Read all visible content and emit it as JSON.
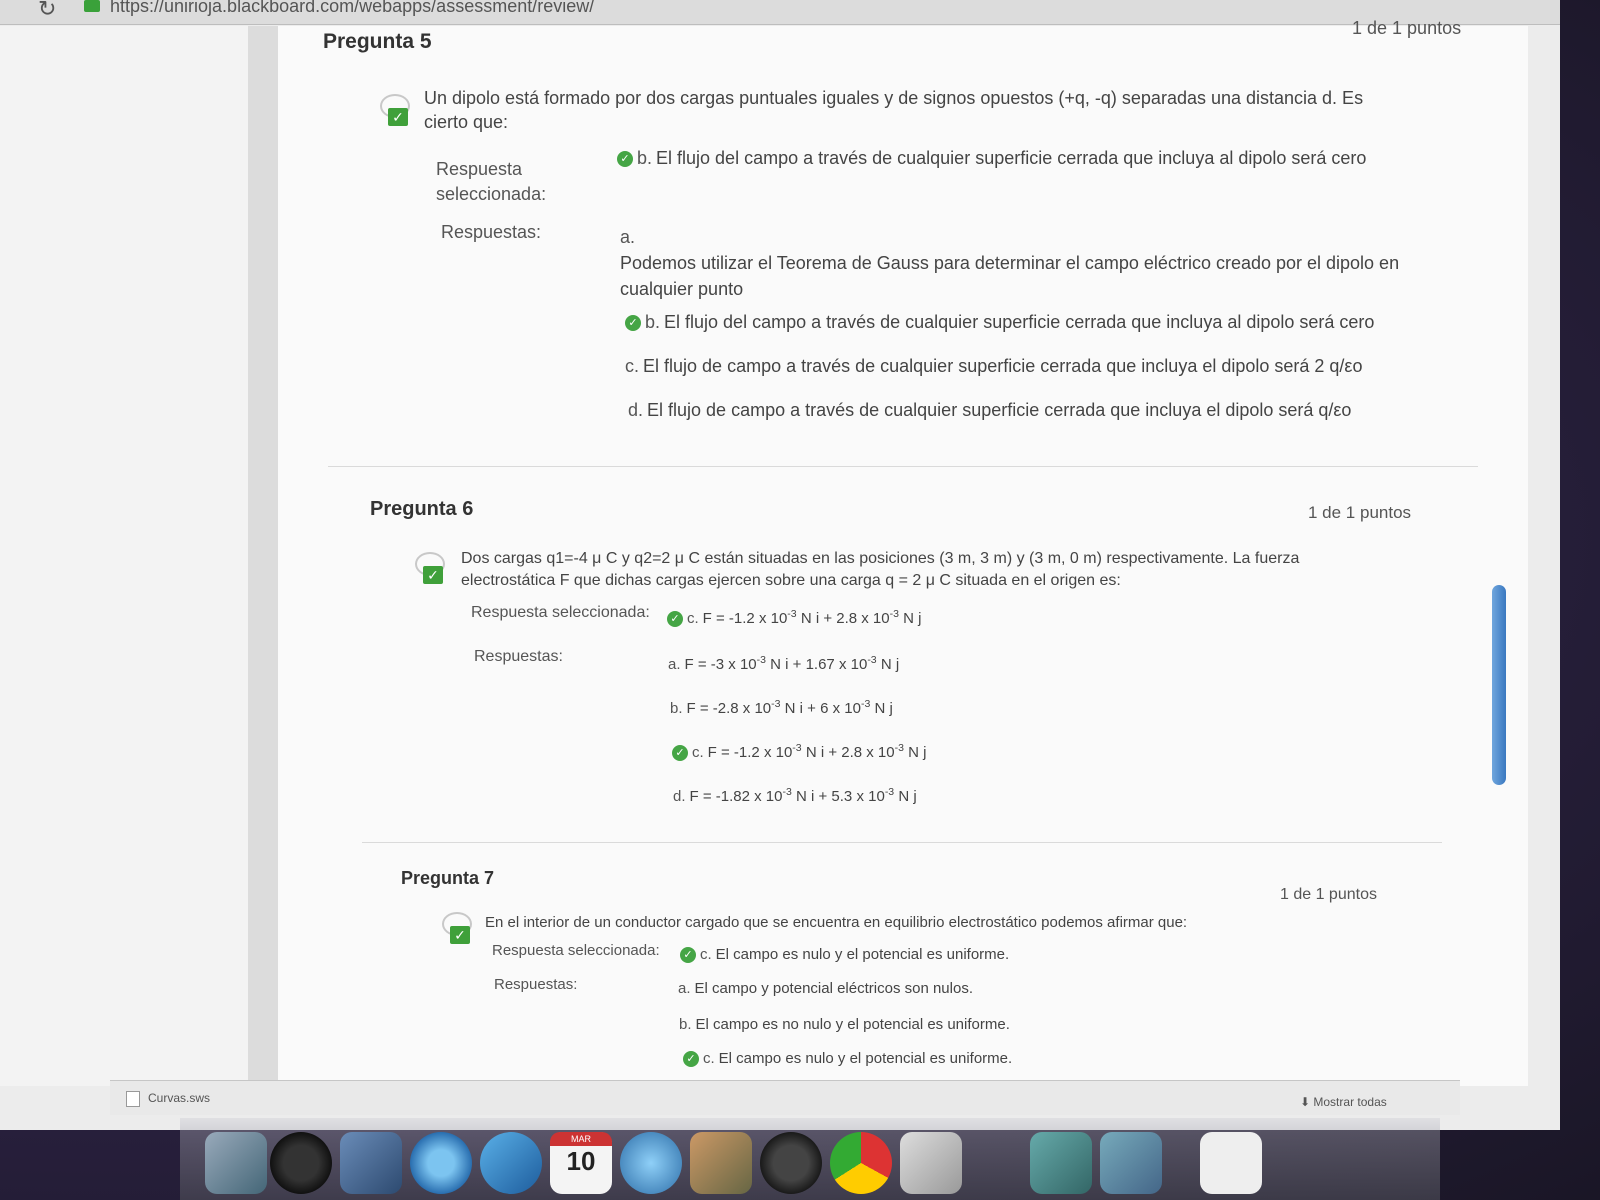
{
  "browser": {
    "url": "https://unirioja.blackboard.com/webapps/assessment/review/"
  },
  "questions": {
    "q5": {
      "title": "Pregunta 5",
      "points": "1 de 1 puntos",
      "stem_line1": "Un dipolo está formado por dos cargas puntuales iguales y de signos opuestos (+q, -q) separadas una distancia d. Es",
      "stem_line2": "cierto que:",
      "selected_label_1": "Respuesta",
      "selected_label_2": "seleccionada:",
      "selected_letter": "b.",
      "selected_text": "El flujo del campo a través de cualquier superficie cerrada que incluya al dipolo será cero",
      "answers_label": "Respuestas:",
      "answers": [
        {
          "letter": "a.",
          "text_1": "Podemos utilizar el Teorema de Gauss para determinar el campo eléctrico creado por el dipolo en",
          "text_2": "cualquier punto"
        },
        {
          "letter": "b.",
          "text": "El flujo del campo a través de cualquier superficie cerrada que incluya al dipolo será cero"
        },
        {
          "letter": "c.",
          "text": "El flujo de campo a través de cualquier superficie cerrada que incluya el dipolo será 2 q/εo"
        },
        {
          "letter": "d.",
          "text": "El flujo de campo a través de cualquier superficie cerrada que incluya el dipolo será q/εo"
        }
      ]
    },
    "q6": {
      "title": "Pregunta 6",
      "points": "1 de 1 puntos",
      "stem_line1": "Dos cargas q1=-4 μ C y q2=2 μ C están situadas en las posiciones (3 m, 3 m) y (3 m, 0 m) respectivamente. La fuerza",
      "stem_line2": "electrostática F que dichas cargas ejercen sobre una carga q = 2 μ C situada en el origen es:",
      "selected_label": "Respuesta seleccionada:",
      "answers_label": "Respuestas:",
      "selected": {
        "letter": "c.",
        "a": "F = -1.2 x 10",
        "b": "N i + 2.8 x 10",
        "c": "N j",
        "exp": "-3"
      },
      "answers": [
        {
          "letter": "a.",
          "a": "F = -3 x 10",
          "b": "N i + 1.67 x 10",
          "c": "N j",
          "exp": "-3"
        },
        {
          "letter": "b.",
          "a": "F = -2.8 x 10",
          "b": "N i + 6 x 10",
          "c": "N j",
          "exp": "-3"
        },
        {
          "letter": "c.",
          "a": "F = -1.2 x 10",
          "b": "N i + 2.8 x 10",
          "c": "N j",
          "exp": "-3"
        },
        {
          "letter": "d.",
          "a": "F = -1.82 x 10",
          "b": "N i + 5.3 x 10",
          "c": "N j",
          "exp": "-3"
        }
      ]
    },
    "q7": {
      "title": "Pregunta 7",
      "points": "1 de 1 puntos",
      "stem": "En el interior de un conductor cargado que se encuentra en equilibrio electrostático podemos afirmar que:",
      "selected_label": "Respuesta seleccionada:",
      "selected_letter": "c.",
      "selected_text": "El campo es nulo y el potencial es uniforme.",
      "answers_label": "Respuestas:",
      "answers": [
        {
          "letter": "a.",
          "text": "El campo y potencial eléctricos son nulos."
        },
        {
          "letter": "b.",
          "text": "El campo es no nulo y el potencial es uniforme."
        },
        {
          "letter": "c.",
          "text": "El campo es nulo y el potencial es uniforme."
        }
      ]
    }
  },
  "download_bar": {
    "file": "Curvas.sws",
    "show_all": "Mostrar todas"
  },
  "dock": {
    "calendar_month": "MAR",
    "calendar_day": "10"
  },
  "colors": {
    "check": "#45a545",
    "accent": "#3a78c0"
  }
}
